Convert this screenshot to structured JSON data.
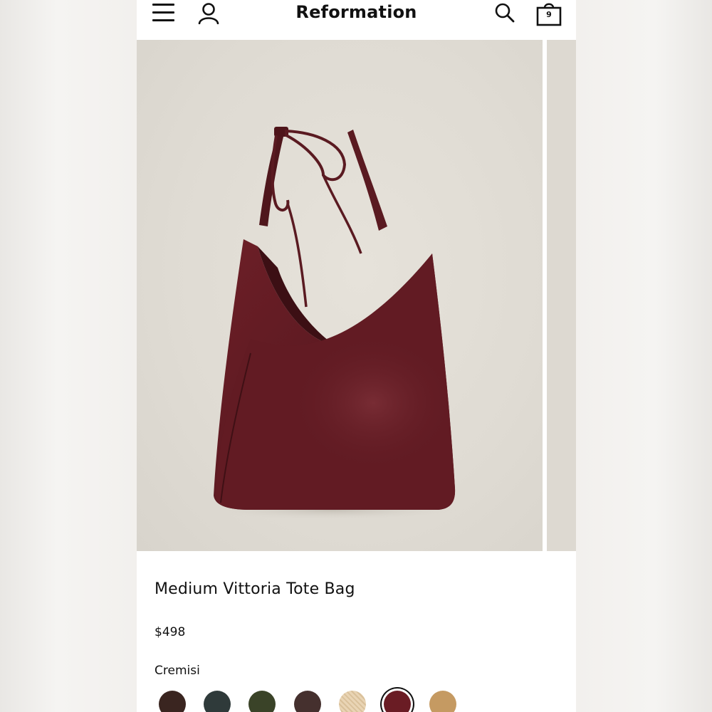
{
  "header": {
    "brand": "Reformation",
    "bag_count": "9",
    "icons": [
      "hamburger-menu-icon",
      "account-icon",
      "search-icon",
      "shopping-bag-icon"
    ]
  },
  "product": {
    "title": "Medium Vittoria Tote Bag",
    "price": "$498",
    "selected_color": "Cremisi",
    "swatches": [
      {
        "color": "#3a2520"
      },
      {
        "color": "#2f3a3a"
      },
      {
        "color": "#3a4328"
      },
      {
        "color": "#45302e"
      },
      {
        "color": "#e7d2b2",
        "pattern": "woven"
      },
      {
        "color": "#6a1c24",
        "selected": true
      },
      {
        "color": "#c59a62"
      }
    ]
  },
  "colors": {
    "bag": "#5e1a22",
    "background_photo": "#dfdbd3",
    "text": "#111111"
  }
}
